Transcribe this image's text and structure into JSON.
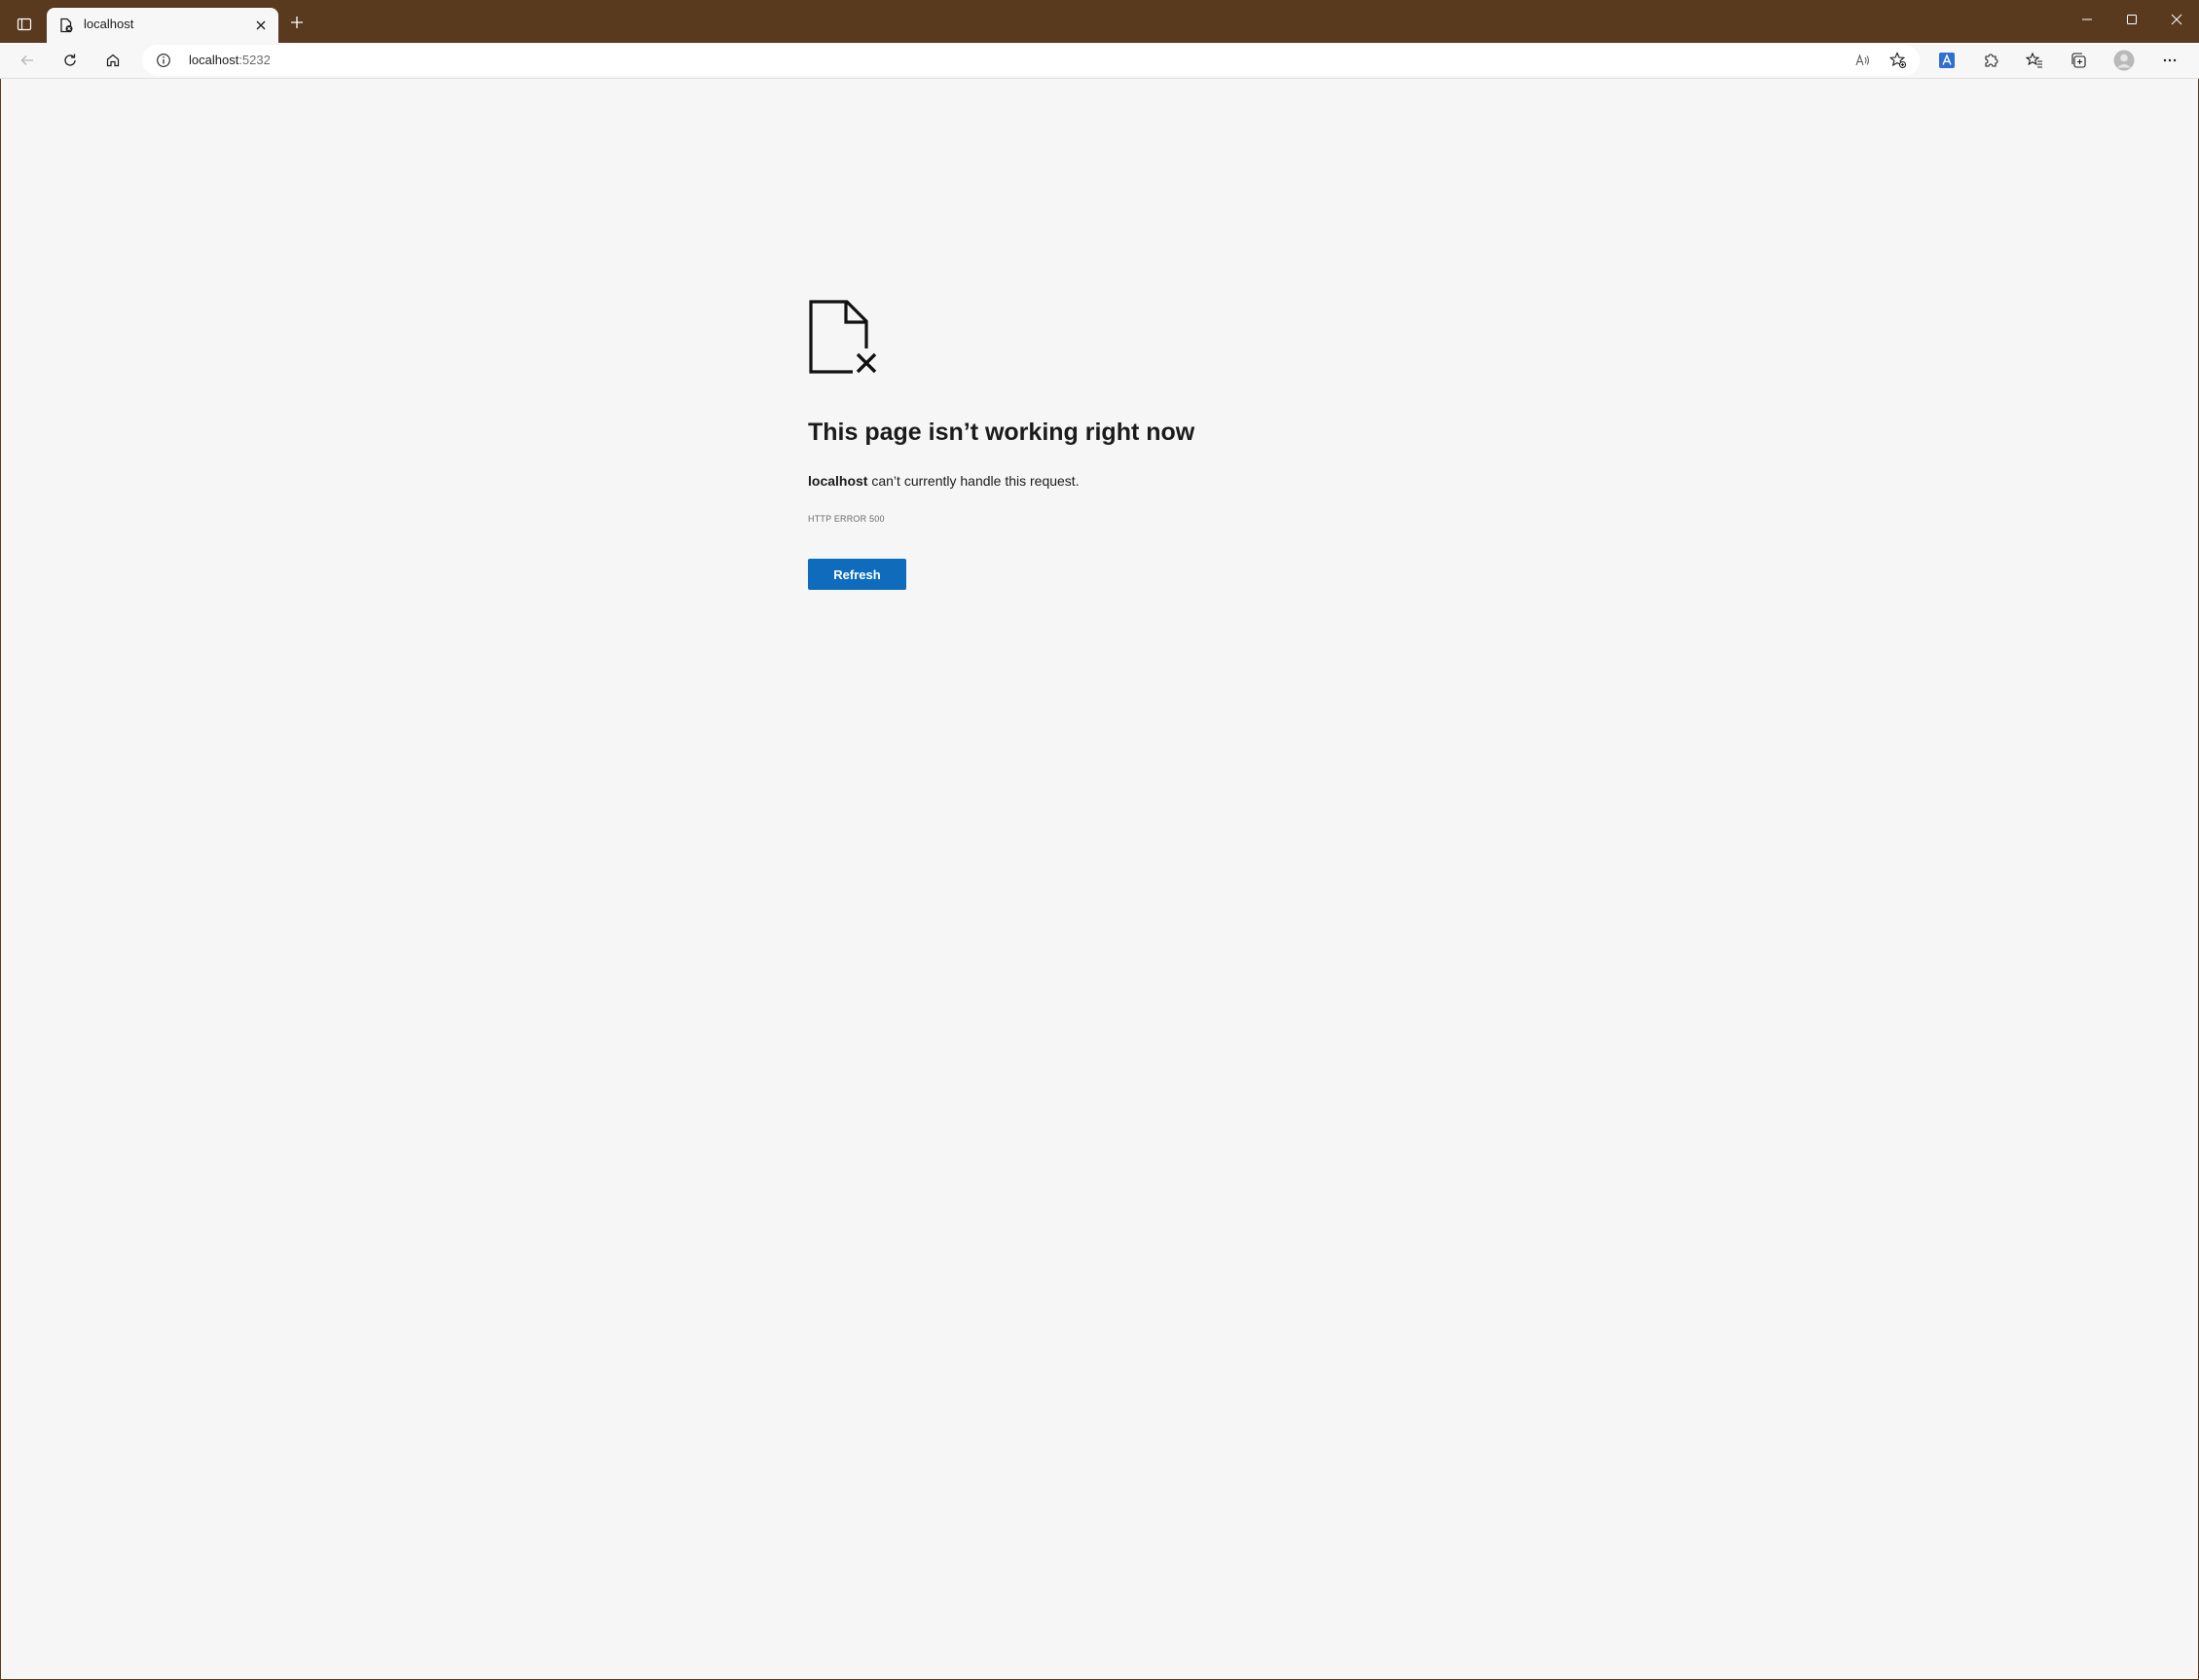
{
  "tab": {
    "title": "localhost"
  },
  "address_bar": {
    "host": "localhost",
    "port": ":5232"
  },
  "error": {
    "title": "This page isn’t working right now",
    "host": "localhost",
    "message": " can’t currently handle this request.",
    "code": "HTTP ERROR 500",
    "button_label": "Refresh"
  },
  "icons": {
    "tab_actions": "tab-actions-icon",
    "favicon": "page-error-favicon",
    "tab_close": "close-icon",
    "new_tab": "plus-icon",
    "minimize": "minimize-icon",
    "maximize": "maximize-icon",
    "close_window": "close-icon",
    "back": "back-arrow-icon",
    "refresh": "refresh-icon",
    "home": "home-icon",
    "site_info": "info-icon",
    "read_aloud": "read-aloud-icon",
    "favorite": "add-favorite-icon",
    "translator": "translator-icon",
    "extensions": "extensions-icon",
    "favorites": "favorites-icon",
    "collections": "collections-icon",
    "profile": "profile-icon",
    "more": "more-icon",
    "error_page": "broken-page-icon"
  },
  "colors": {
    "titlebar": "#5a3a1e",
    "toolbar": "#f7f7f7",
    "content_bg": "#f6f6f6",
    "accent": "#0f6cbd"
  }
}
